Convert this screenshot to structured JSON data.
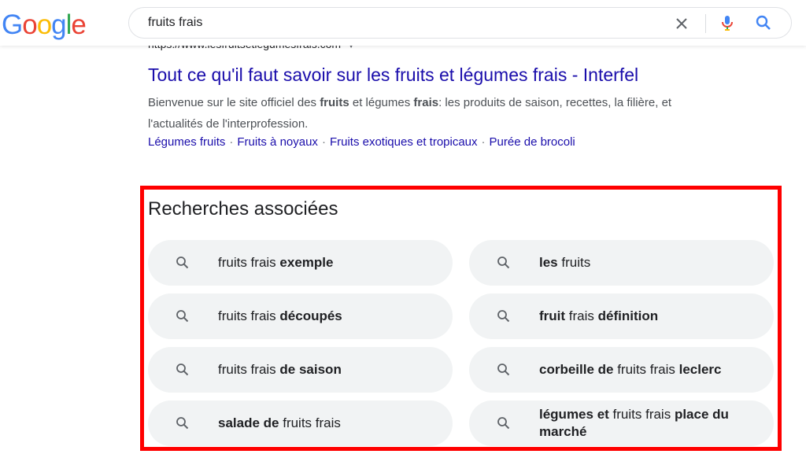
{
  "header": {
    "logo_letters": [
      {
        "ch": "G",
        "color": "#4285F4"
      },
      {
        "ch": "o",
        "color": "#EA4335"
      },
      {
        "ch": "o",
        "color": "#FBBC05"
      },
      {
        "ch": "g",
        "color": "#4285F4"
      },
      {
        "ch": "l",
        "color": "#34A853"
      },
      {
        "ch": "e",
        "color": "#EA4335"
      }
    ],
    "query": "fruits frais",
    "icons": {
      "clear": "close-icon",
      "voice": "microphone-icon",
      "search": "search-icon"
    }
  },
  "result": {
    "url": "https://www.lesfruitsetlegumesfrais.com",
    "title": "Tout ce qu'il faut savoir sur les fruits et légumes frais - Interfel",
    "snippet_parts": [
      {
        "t": "Bienvenue sur le site officiel des ",
        "b": false
      },
      {
        "t": "fruits",
        "b": true
      },
      {
        "t": " et légumes ",
        "b": false
      },
      {
        "t": "frais",
        "b": true
      },
      {
        "t": ": les produits de saison, recettes, la filière, et l'actualités de l'interprofession.",
        "b": false
      }
    ],
    "sitelinks": [
      "Légumes fruits",
      "Fruits à noyaux",
      "Fruits exotiques et tropicaux",
      "Purée de brocoli"
    ],
    "sitelink_separator": "·"
  },
  "related": {
    "title": "Recherches associées",
    "highlight_color": "#ff0000",
    "items": [
      {
        "parts": [
          {
            "t": "fruits frais ",
            "b": false
          },
          {
            "t": "exemple",
            "b": true
          }
        ]
      },
      {
        "parts": [
          {
            "t": "les",
            "b": true
          },
          {
            "t": " fruits",
            "b": false
          }
        ]
      },
      {
        "parts": [
          {
            "t": "fruits frais ",
            "b": false
          },
          {
            "t": "découpés",
            "b": true
          }
        ]
      },
      {
        "parts": [
          {
            "t": "fruit",
            "b": true
          },
          {
            "t": " frais ",
            "b": false
          },
          {
            "t": "définition",
            "b": true
          }
        ]
      },
      {
        "parts": [
          {
            "t": "fruits frais ",
            "b": false
          },
          {
            "t": "de saison",
            "b": true
          }
        ]
      },
      {
        "parts": [
          {
            "t": "corbeille de",
            "b": true
          },
          {
            "t": " fruits frais ",
            "b": false
          },
          {
            "t": "leclerc",
            "b": true
          }
        ]
      },
      {
        "parts": [
          {
            "t": "salade de",
            "b": true
          },
          {
            "t": " fruits frais",
            "b": false
          }
        ]
      },
      {
        "parts": [
          {
            "t": "légumes et",
            "b": true
          },
          {
            "t": " fruits frais ",
            "b": false
          },
          {
            "t": "place du marché",
            "b": true
          }
        ]
      }
    ]
  }
}
